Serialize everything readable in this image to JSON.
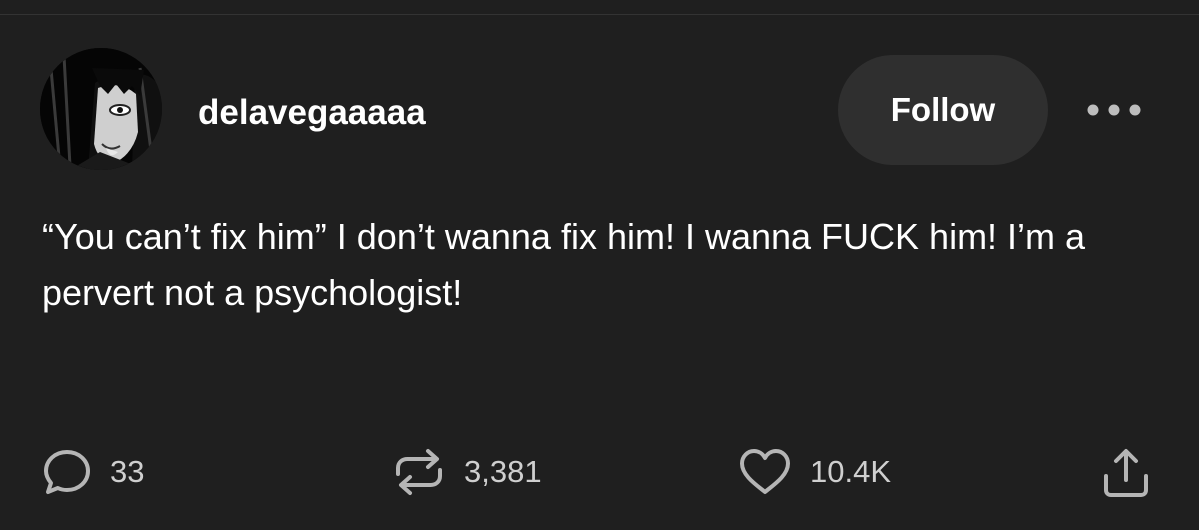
{
  "post": {
    "author": {
      "username": "delavegaaaaa",
      "avatar": "avatar-illustration"
    },
    "follow_label": "Follow",
    "more_icon": "more-horizontal-icon",
    "text": "“You can’t fix him” I don’t wanna fix him! I wanna FUCK him! I’m a pervert not a psychologist!",
    "actions": {
      "replies": {
        "icon": "comment-icon",
        "count": "33"
      },
      "reposts": {
        "icon": "repost-icon",
        "count": "3,381"
      },
      "likes": {
        "icon": "heart-icon",
        "count": "10.4K"
      },
      "share": {
        "icon": "share-icon"
      }
    }
  },
  "colors": {
    "background": "#1f1f1f",
    "follow_button_bg": "#2f2f2f",
    "text": "#ffffff",
    "muted": "#cfcfcf",
    "icon": "#b5b5b5"
  }
}
